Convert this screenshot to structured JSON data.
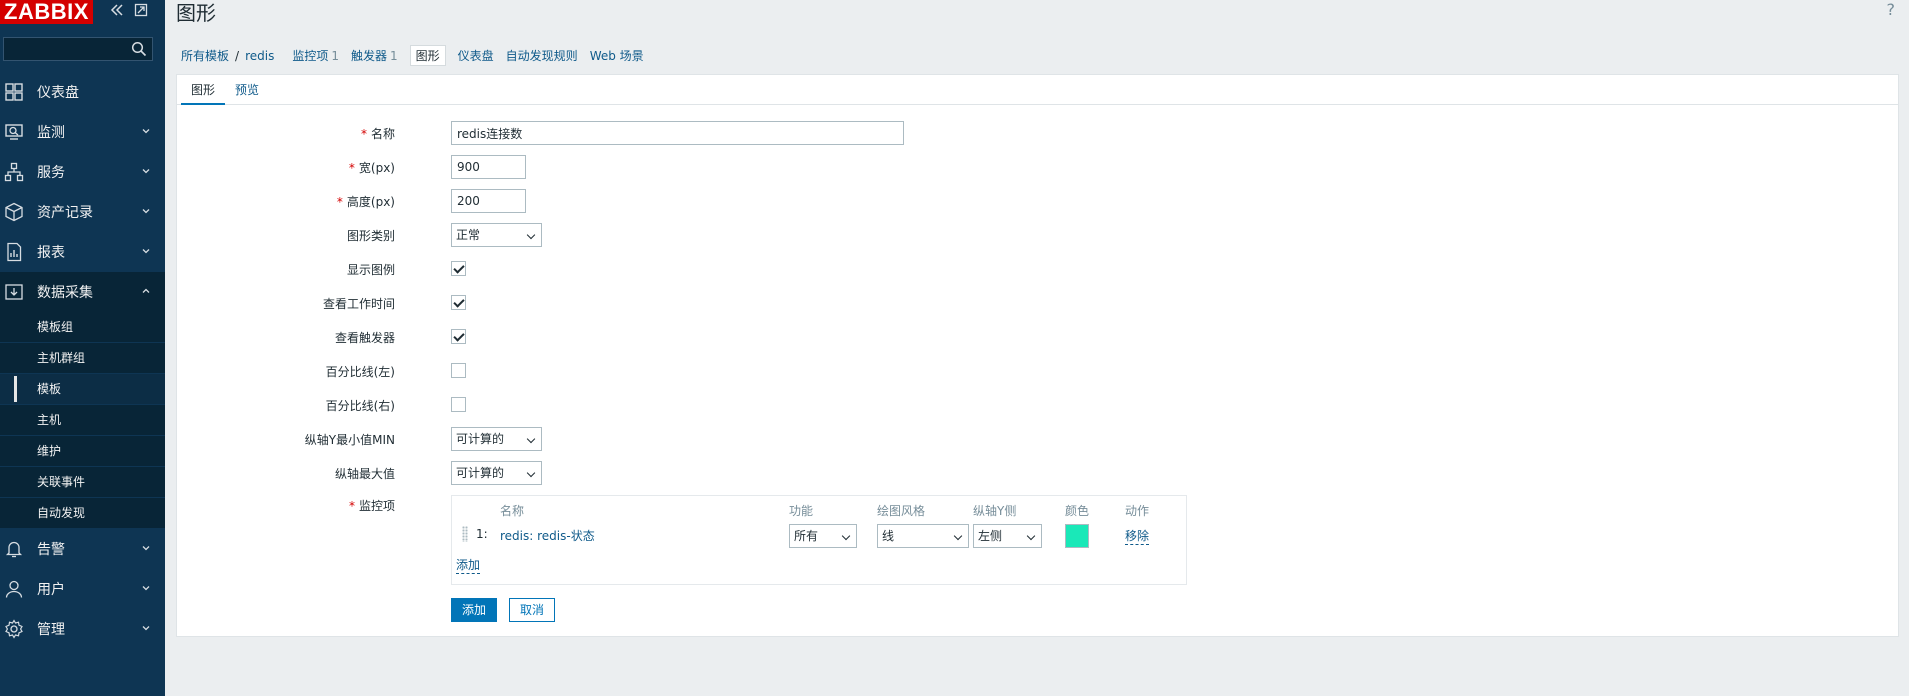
{
  "app": {
    "logo": "ZABBIX",
    "page_title": "图形",
    "help": "?"
  },
  "colors": {
    "sidebar_bg": "#0e3553",
    "brand": "#d40000",
    "accent": "#0275b8",
    "item_color": "#1ae8b8"
  },
  "sidebar": {
    "search_placeholder": "",
    "menu": [
      {
        "label": "仪表盘",
        "icon": "dashboard-icon"
      },
      {
        "label": "监测",
        "icon": "monitoring-icon"
      },
      {
        "label": "服务",
        "icon": "services-icon"
      },
      {
        "label": "资产记录",
        "icon": "inventory-icon"
      },
      {
        "label": "报表",
        "icon": "reports-icon"
      },
      {
        "label": "数据采集",
        "icon": "data-collection-icon"
      },
      {
        "label": "告警",
        "icon": "alerts-icon"
      },
      {
        "label": "用户",
        "icon": "users-icon"
      },
      {
        "label": "管理",
        "icon": "administration-icon"
      }
    ],
    "submenu": [
      "模板组",
      "主机群组",
      "模板",
      "主机",
      "维护",
      "关联事件",
      "自动发现"
    ]
  },
  "nav": {
    "all_templates": "所有模板",
    "separator": "/",
    "template": "redis",
    "items": {
      "label": "监控项",
      "count": "1"
    },
    "triggers": {
      "label": "触发器",
      "count": "1"
    },
    "graphs": "图形",
    "dashboards": "仪表盘",
    "discovery": "自动发现规则",
    "web": "Web 场景"
  },
  "tabs": [
    "图形",
    "预览"
  ],
  "form": {
    "name": {
      "label": "名称",
      "value": "redis连接数"
    },
    "width": {
      "label": "宽(px)",
      "value": "900"
    },
    "height": {
      "label": "高度(px)",
      "value": "200"
    },
    "graph_type": {
      "label": "图形类别",
      "value": "正常"
    },
    "show_legend": {
      "label": "显示图例",
      "checked": true
    },
    "show_working_time": {
      "label": "查看工作时间",
      "checked": true
    },
    "show_triggers": {
      "label": "查看触发器",
      "checked": true
    },
    "percentile_left": {
      "label": "百分比线(左)",
      "checked": false
    },
    "percentile_right": {
      "label": "百分比线(右)",
      "checked": false
    },
    "y_min": {
      "label": "纵轴Y最小值MIN",
      "value": "可计算的"
    },
    "y_max": {
      "label": "纵轴最大值",
      "value": "可计算的"
    },
    "items_label": "监控项"
  },
  "items_table": {
    "headers": {
      "name": "名称",
      "function": "功能",
      "draw_style": "绘图风格",
      "y_side": "纵轴Y侧",
      "color": "颜色",
      "action": "动作"
    },
    "rows": [
      {
        "index": "1:",
        "name": "redis: redis-状态",
        "function": "所有",
        "draw_style": "线",
        "y_side": "左侧",
        "action": "移除"
      }
    ],
    "add_link": "添加"
  },
  "buttons": {
    "add": "添加",
    "cancel": "取消"
  }
}
